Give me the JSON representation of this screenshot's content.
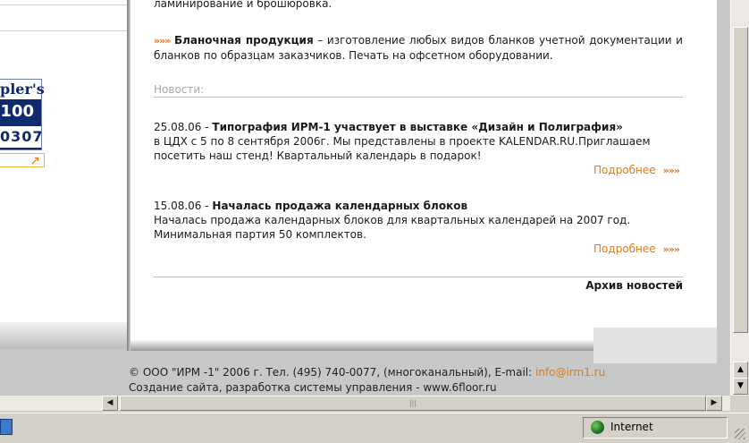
{
  "sidebar": {
    "banner_line1": "pler's",
    "banner_line2": "100",
    "banner_line3": "0307",
    "banner_link_icon": "↗"
  },
  "main": {
    "top_text": "ламинирование и брошюровка.",
    "arrows": "»»»",
    "blank_title": "Бланочная продукция",
    "blank_text": " – изготовление любых видов бланков учетной документации и бланков по образцам заказчиков. Печать на офсетном оборудовании.",
    "news_heading": "Новости:",
    "news": [
      {
        "date": "25.08.06 - ",
        "title": "Типография ИРМ-1 участвует в выставке «Дизайн и Полиграфия»",
        "body": "в ЦДХ с 5 по 8 сентября 2006г. Мы представлены в проекте KALENDAR.RU.Приглашаем посетить наш стенд! Квартальный календарь в подарок!",
        "more": "Подробнее"
      },
      {
        "date": "15.08.06 - ",
        "title": "Началась продажа календарных блоков",
        "body": "Началась продажа календарных блоков для квартальных календарей на 2007 год. Минимальная партия 50 комплектов.",
        "more": "Подробнее"
      }
    ],
    "archive": "Архив новостей"
  },
  "footer": {
    "line1_prefix": "© ООО \"ИРМ -1\" 2006 г. Тел. (495) 740-0077, (многоканальный), E-mail: ",
    "email": "info@irm1.ru",
    "line2": "Создание сайта, разработка системы управления - www.6floor.ru"
  },
  "statusbar": {
    "zone": "Internet",
    "zone_icon": "globe-icon"
  },
  "colors": {
    "accent": "#e07a10",
    "banner": "#102a6e"
  }
}
